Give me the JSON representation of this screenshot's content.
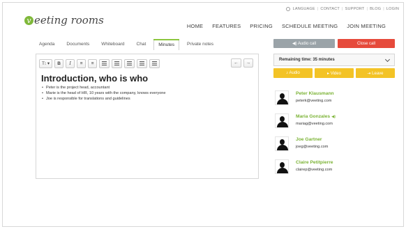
{
  "utility_nav": {
    "language": "LANGUAGE",
    "contact": "CONTACT",
    "support": "SUPPORT",
    "blog": "BLOG",
    "login": "LOGIN",
    "separator": "|"
  },
  "logo": {
    "mark": "v",
    "word": "eeting rooms"
  },
  "main_nav": [
    "HOME",
    "FEATURES",
    "PRICING",
    "SCHEDULE MEETING",
    "JOIN MEETING"
  ],
  "tabs": {
    "items": [
      "Agenda",
      "Documents",
      "Whiteboard",
      "Chat",
      "Minutes",
      "Private notes"
    ],
    "active": "Minutes",
    "accent": "#8cc63f"
  },
  "toolbar": {
    "text_style": "T⁝ ▾",
    "bold": "B",
    "italic": "I",
    "ordered_list": "≡",
    "unordered_list": "≡",
    "undo": "←",
    "redo": "→"
  },
  "document": {
    "heading": "Introduction, who is who",
    "bullets": [
      "Peter is the project head, accountant",
      "Marie is the head of HR, 10 years with the company, knows everyone",
      "Joe is responsible for translations and guidelines"
    ]
  },
  "call_controls": {
    "audio_call": "◀) Audio call",
    "close_call": "Close call",
    "remaining_time": "Remaining time: 35 minutes",
    "audio": "♪ Audio",
    "video": "▸ Video",
    "leave": "⇥ Leave",
    "colors": {
      "audio_call": "#9aa3a8",
      "close_call": "#e64a3b",
      "actions": "#f3c326",
      "names": "#7bb335"
    }
  },
  "participants": [
    {
      "name": "Peter Klausmann",
      "email": "peterk@veeting.com",
      "speaking": ""
    },
    {
      "name": "Maria Gonzales",
      "email": "mariag@veeting.com",
      "speaking": "◀)"
    },
    {
      "name": "Joe Gartner",
      "email": "joeg@veeting.com",
      "speaking": ""
    },
    {
      "name": "Claire Petitpierre",
      "email": "clairep@veeting.com",
      "speaking": ""
    }
  ]
}
